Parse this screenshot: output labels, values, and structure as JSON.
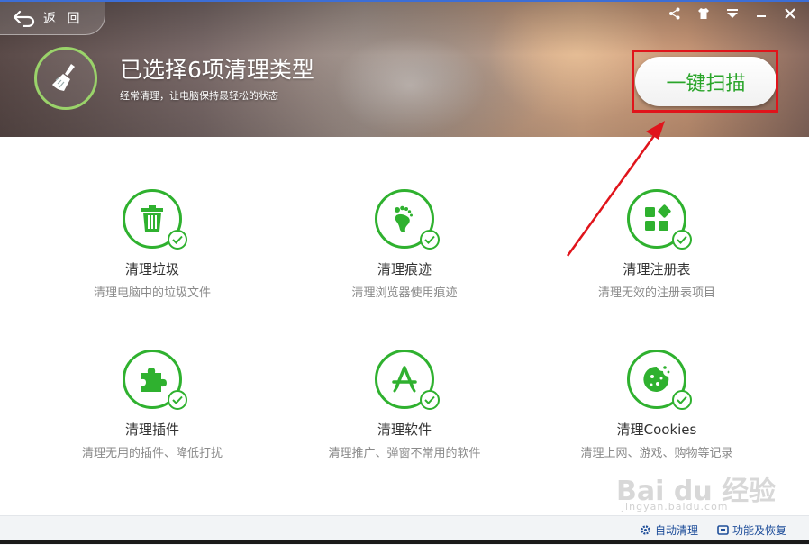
{
  "header": {
    "back_label": "返 回",
    "headline": "已选择6项清理类型",
    "subline": "经常清理，让电脑保持最轻松的状态",
    "scan_button": "一键扫描"
  },
  "window_controls": [
    "share-icon",
    "skin-icon",
    "menu-icon",
    "minimize-icon",
    "close-icon"
  ],
  "items": [
    {
      "title": "清理垃圾",
      "desc": "清理电脑中的垃圾文件",
      "icon": "trash-icon"
    },
    {
      "title": "清理痕迹",
      "desc": "清理浏览器使用痕迹",
      "icon": "footprint-icon"
    },
    {
      "title": "清理注册表",
      "desc": "清理无效的注册表项目",
      "icon": "registry-icon"
    },
    {
      "title": "清理插件",
      "desc": "清理无用的插件、降低打扰",
      "icon": "puzzle-icon"
    },
    {
      "title": "清理软件",
      "desc": "清理推广、弹窗不常用的软件",
      "icon": "appstore-icon"
    },
    {
      "title": "清理Cookies",
      "desc": "清理上网、游戏、购物等记录",
      "icon": "cookie-icon"
    }
  ],
  "footer": {
    "auto_clean": "自动清理",
    "restore": "功能及恢复"
  },
  "watermark": {
    "main": "Bai du 经验",
    "sub": "jingyan.baidu.com"
  },
  "colors": {
    "accent": "#2fb12f",
    "highlight": "#e0141b",
    "link": "#1f4e9a"
  }
}
